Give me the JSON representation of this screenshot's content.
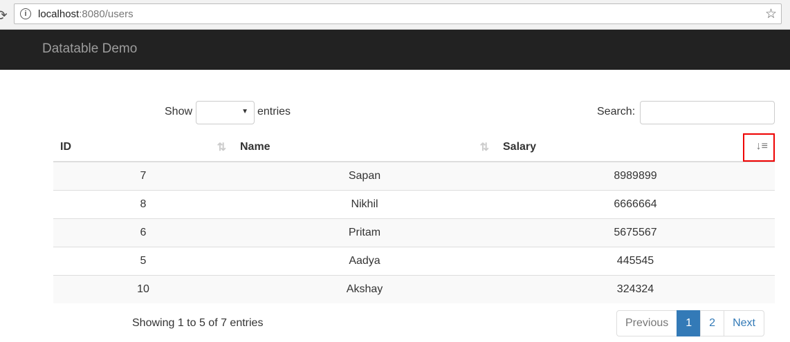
{
  "browser": {
    "url_host": "localhost",
    "url_rest": ":8080/users"
  },
  "navbar": {
    "brand": "Datatable Demo"
  },
  "controls": {
    "show_label": "Show",
    "entries_label": "entries",
    "search_label": "Search:",
    "search_value": ""
  },
  "table": {
    "headers": [
      "ID",
      "Name",
      "Salary"
    ],
    "rows": [
      [
        "7",
        "Sapan",
        "8989899"
      ],
      [
        "8",
        "Nikhil",
        "6666664"
      ],
      [
        "6",
        "Pritam",
        "5675567"
      ],
      [
        "5",
        "Aadya",
        "445545"
      ],
      [
        "10",
        "Akshay",
        "324324"
      ]
    ]
  },
  "footer": {
    "info": "Showing 1 to 5 of 7 entries",
    "previous": "Previous",
    "pages": [
      "1",
      "2"
    ],
    "next": "Next"
  }
}
